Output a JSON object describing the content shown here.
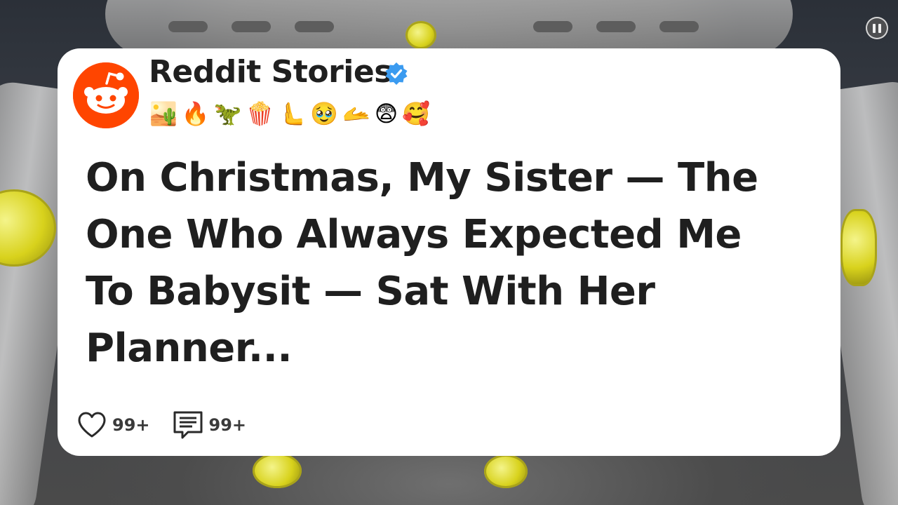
{
  "card": {
    "channel_name": "Reddit Stories",
    "avatar_icon": "reddit-alien-icon",
    "verified_icon": "verified-badge-icon",
    "emoji_row": [
      "🏜️",
      "🔥",
      "🦖",
      "🍿",
      "🫷",
      "🥹",
      "🫴",
      "😨",
      "🥰"
    ],
    "title": "On Christmas, My Sister — The One Who Always Expected Me To Babysit — Sat With Her Planner...",
    "likes": {
      "icon": "heart-icon",
      "count": "99+"
    },
    "comments": {
      "icon": "comment-icon",
      "count": "99+"
    }
  },
  "player": {
    "pause_icon": "pause-icon"
  },
  "colors": {
    "reddit_orange": "#ff4500",
    "verified_blue": "#3b9bf0",
    "card_background": "#ffffff",
    "text": "#1f1f1f"
  }
}
